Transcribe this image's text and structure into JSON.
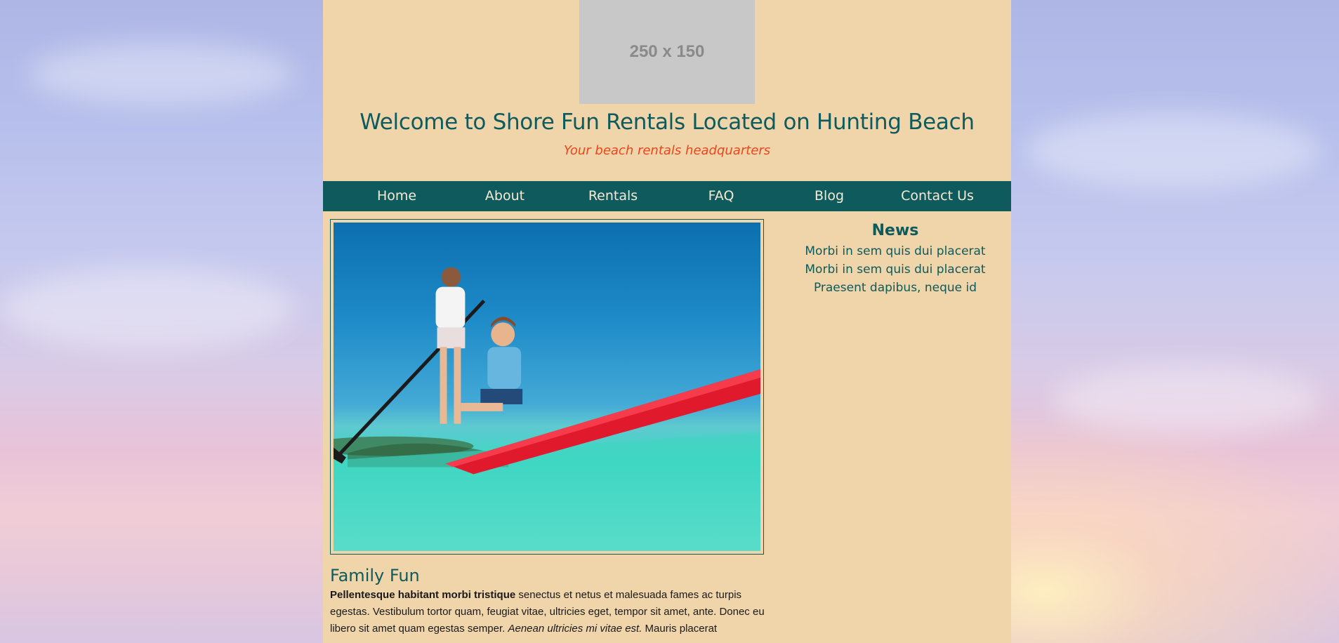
{
  "header": {
    "logo_placeholder": "250 x 150",
    "title": "Welcome to Shore Fun Rentals Located on Hunting Beach",
    "tagline": "Your beach rentals headquarters"
  },
  "nav": {
    "items": [
      "Home",
      "About",
      "Rentals",
      "FAQ",
      "Blog",
      "Contact Us"
    ]
  },
  "main": {
    "heading": "Family Fun",
    "body_bold": "Pellentesque habitant morbi tristique",
    "body_plain_1": " senectus et netus et malesuada fames ac turpis egestas. Vestibulum tortor quam, feugiat vitae, ultricies eget, tempor sit amet, ante. Donec eu libero sit amet quam egestas semper. ",
    "body_italic": "Aenean ultricies mi vitae est.",
    "body_plain_2": " Mauris placerat"
  },
  "sidebar": {
    "news_heading": "News",
    "news_items": [
      "Morbi in sem quis dui placerat",
      "Morbi in sem quis dui placerat",
      "Praesent dapibus, neque id"
    ]
  },
  "colors": {
    "teal": "#0e5a5c",
    "sand": "#f0d5ab",
    "tagline_orange": "#e8471c"
  }
}
